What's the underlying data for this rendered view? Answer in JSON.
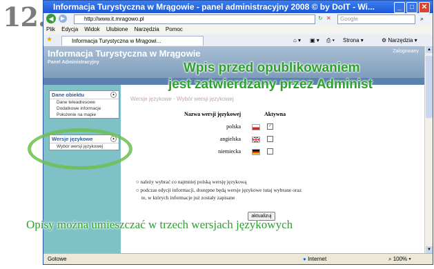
{
  "step_number": "12.",
  "browser": {
    "title": "Informacja Turystyczna w Mrągowie - panel administracyjny 2008 © by DoIT - Wi...",
    "url": "http://www.it.mragowo.pl",
    "search_placeholder": "Google",
    "menu": [
      "Plik",
      "Edycja",
      "Widok",
      "Ulubione",
      "Narzędzia",
      "Pomoc"
    ],
    "tab_label": "Informacja Turystyczna w Mrągowi...",
    "toolbar_page": "Strona",
    "toolbar_tools": "Narzędzia",
    "status_left": "Gotowe",
    "status_zone": "Internet",
    "zoom": "100%"
  },
  "site": {
    "title": "Informacja Turystyczna w Mrągowie",
    "subtitle": "Panel Administracyjny",
    "login": "Zalogowany"
  },
  "sidebar": {
    "object_data_title": "Dane obiektu",
    "object_items": [
      "Dane teleadresowe",
      "Dodatkowe informacje",
      "Położenie na mapie"
    ],
    "languages_title": "Wersje językowe",
    "language_items": [
      "Wybór wersji językowej"
    ]
  },
  "content": {
    "breadcrumb": "Wersje językowe - Wybór wersji językowej",
    "col_name": "Nazwa wersji językowej",
    "col_active": "Aktywna",
    "languages": [
      {
        "name": "polska",
        "active": true
      },
      {
        "name": "angielska",
        "active": false
      },
      {
        "name": "niemiecka",
        "active": false
      }
    ],
    "notes": [
      "należy wybrać co najmniej polską wersję językową",
      "podczas edycji informacji, dostępne będą wersje językowe tutaj wybrane oraz",
      "te, w których informacje już zostały zapisane"
    ],
    "update_button": "aktualizuj"
  },
  "overlay": {
    "top_line1": "Wpis przed opublikowaniem",
    "top_line2": "jest zatwierdzany przez Administ",
    "bottom": "Opisy można umieszczać w trzech wersjach językowych"
  },
  "colors": {
    "accent_green": "#2ea02e",
    "sidebar_teal": "#7fc1c7"
  }
}
